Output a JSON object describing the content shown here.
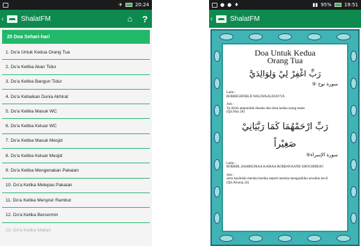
{
  "left": {
    "status": {
      "time": "20:24"
    },
    "appbar": {
      "title": "ShalatFM",
      "home_icon": "home-icon",
      "help_label": "?"
    },
    "list_header": "25 Doa Sehari-hari",
    "items": [
      "1. Do'a Untuk Kedua Orang Tua",
      "2. Do'a Ketika Akan Tidur",
      "3. Do'a Ketika Bangun Tidur",
      "4. Do'a Kebaikan Dunia Akhirat",
      "5. Do'a Ketika Masuk WC",
      "6. Do'a Ketika Keluar WC",
      "7. Do'a Ketika Masuk Mesjid",
      "8. Do'a Ketika Keluar Mesjid",
      "9. Do'a Ketika Mengenakan Pakaian",
      "10. Do'a Ketika Melepas Pakaian",
      "11. Do'a Ketika Menyisir Rambut",
      "12. Do'a Ketika Bercermin",
      "13. Do'a Ketika Makan"
    ]
  },
  "right": {
    "status": {
      "battery": "95%",
      "time": "19:51"
    },
    "appbar": {
      "title": "ShalatFM"
    },
    "doa": {
      "title_line1": "Doa Untuk Kedua",
      "title_line2": "Orang Tua",
      "arabic1": "رَبِّ اغْفِرْ لِيْ وَلِوَالِدَيَّ",
      "source1": "سورة نوح ⑤",
      "latin_label1": "Latin :",
      "latin1": "ROBBIGHFIRLII WALIWAALIDAYYA",
      "arti_label1": "Arti :",
      "arti1": "Ya Alloh ampunilah dosaku dan dosa kedua orang tuaku",
      "ref1": "(QS.Nuh 28)",
      "arabic2": "رَبِّ ارْحَمْهُمَا كَمَا رَبَّيَانِيْ",
      "arabic3": "صَغِيْراً",
      "source2": "سورة الإسراء⑤",
      "latin_label2": "Latin :",
      "latin2": "ROBBIR_HAMHUMAA KAMAA ROBBAYAANII SHOGHIIROO",
      "arti_label2": "Arti :",
      "arti2": "serta kasihilah mereka berdua seperti mereka mengasihiku sewaktu kecil",
      "ref2": "(QS.Alisroq 24)"
    }
  },
  "colors": {
    "appbar": "#0e8a4f",
    "header": "#22b86a",
    "divider": "#2bb673",
    "frame": "#40b3b5"
  }
}
